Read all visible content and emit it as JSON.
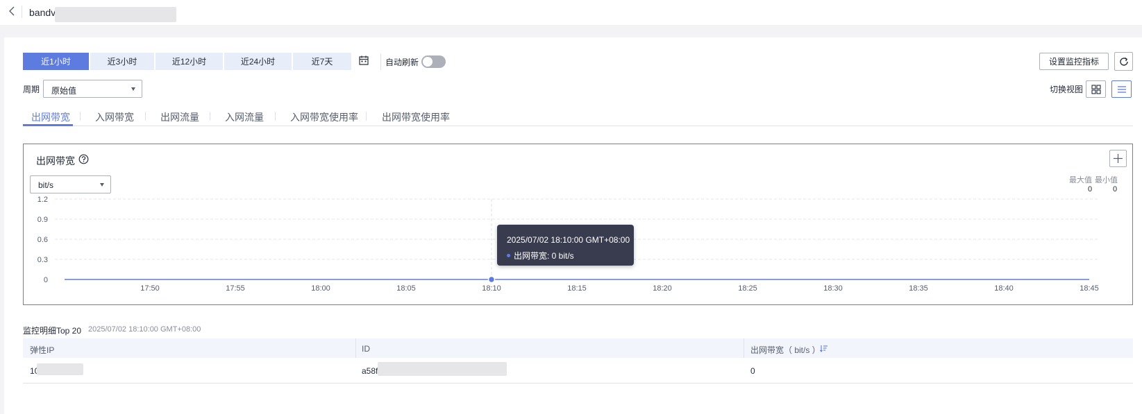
{
  "header": {
    "title_visible": "bandv"
  },
  "time_ranges": [
    "近1小时",
    "近3小时",
    "近12小时",
    "近24小时",
    "近7天"
  ],
  "selected_time_range": "近1小时",
  "auto_refresh": {
    "label": "自动刷新",
    "on": false
  },
  "toolbar": {
    "set_metrics_label": "设置监控指标",
    "switch_view_label": "切换视图"
  },
  "period": {
    "label": "周期",
    "value": "原始值"
  },
  "tabs": [
    "出网带宽",
    "入网带宽",
    "出网流量",
    "入网流量",
    "入网带宽使用率",
    "出网带宽使用率"
  ],
  "active_tab": "出网带宽",
  "chart_panel": {
    "title": "出网带宽",
    "unit_select": "bit/s",
    "max_label": "最大值",
    "min_label": "最小值",
    "max_value": "0",
    "min_value": "0",
    "tooltip": {
      "time": "2025/07/02 18:10:00 GMT+08:00",
      "text": "出网带宽: 0 bit/s"
    }
  },
  "chart_data": {
    "type": "line",
    "title": "出网带宽",
    "xlabel": "",
    "ylabel": "",
    "ylim": [
      0,
      1.2
    ],
    "y_ticks": [
      "1.2",
      "0.9",
      "0.6",
      "0.3",
      "0"
    ],
    "x_ticks": [
      "17:50",
      "17:55",
      "18:00",
      "18:05",
      "18:10",
      "18:15",
      "18:20",
      "18:25",
      "18:30",
      "18:35",
      "18:40",
      "18:45"
    ],
    "x_range": [
      "17:45",
      "18:45"
    ],
    "series": [
      {
        "values": [
          [
            "17:45",
            0
          ],
          [
            "18:10",
            0
          ],
          [
            "18:45",
            0
          ]
        ]
      }
    ],
    "highlight": {
      "x": "18:10",
      "y": 0
    },
    "grid": true,
    "color": "#5e7ce0"
  },
  "table": {
    "title": "监控明细Top  20",
    "timestamp": "2025/07/02  18:10:00  GMT+08:00",
    "columns": [
      "弹性IP",
      "ID",
      "出网带宽（ bit/s ）"
    ],
    "rows": [
      [
        "10",
        "a58f",
        "0"
      ]
    ]
  },
  "colors": {
    "accent": "#5e7ce0",
    "tab_bg": "#e8eef9",
    "text": "#252b3a"
  }
}
